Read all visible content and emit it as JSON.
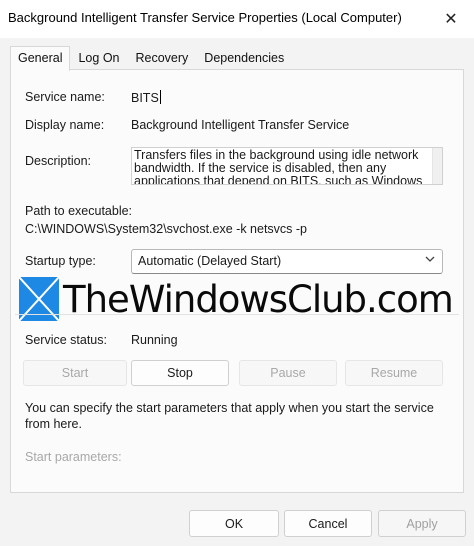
{
  "window": {
    "title": "Background Intelligent Transfer Service Properties (Local Computer)",
    "close_glyph": "✕"
  },
  "tabs": [
    {
      "label": "General",
      "active": true
    },
    {
      "label": "Log On",
      "active": false
    },
    {
      "label": "Recovery",
      "active": false
    },
    {
      "label": "Dependencies",
      "active": false
    }
  ],
  "general": {
    "service_name_label": "Service name:",
    "service_name_value": "BITS",
    "display_name_label": "Display name:",
    "display_name_value": "Background Intelligent Transfer Service",
    "description_label": "Description:",
    "description_value": "Transfers files in the background using idle network bandwidth. If the service is disabled, then any applications that depend on BITS, such as Windows",
    "path_label": "Path to executable:",
    "path_value": "C:\\WINDOWS\\System32\\svchost.exe -k netsvcs -p",
    "startup_type_label": "Startup type:",
    "startup_type_value": "Automatic (Delayed Start)",
    "service_status_label": "Service status:",
    "service_status_value": "Running",
    "buttons": {
      "start": "Start",
      "stop": "Stop",
      "pause": "Pause",
      "resume": "Resume"
    },
    "info_text": "You can specify the start parameters that apply when you start the service from here.",
    "start_params_label": "Start parameters:"
  },
  "watermark": {
    "text": "TheWindowsClub.com",
    "color": "#1e88e5"
  },
  "footer": {
    "ok": "OK",
    "cancel": "Cancel",
    "apply": "Apply"
  },
  "icons": {
    "close": "close-icon",
    "dropdown": "chevron-down-icon",
    "watermark_logo": "windows-logo-icon"
  }
}
